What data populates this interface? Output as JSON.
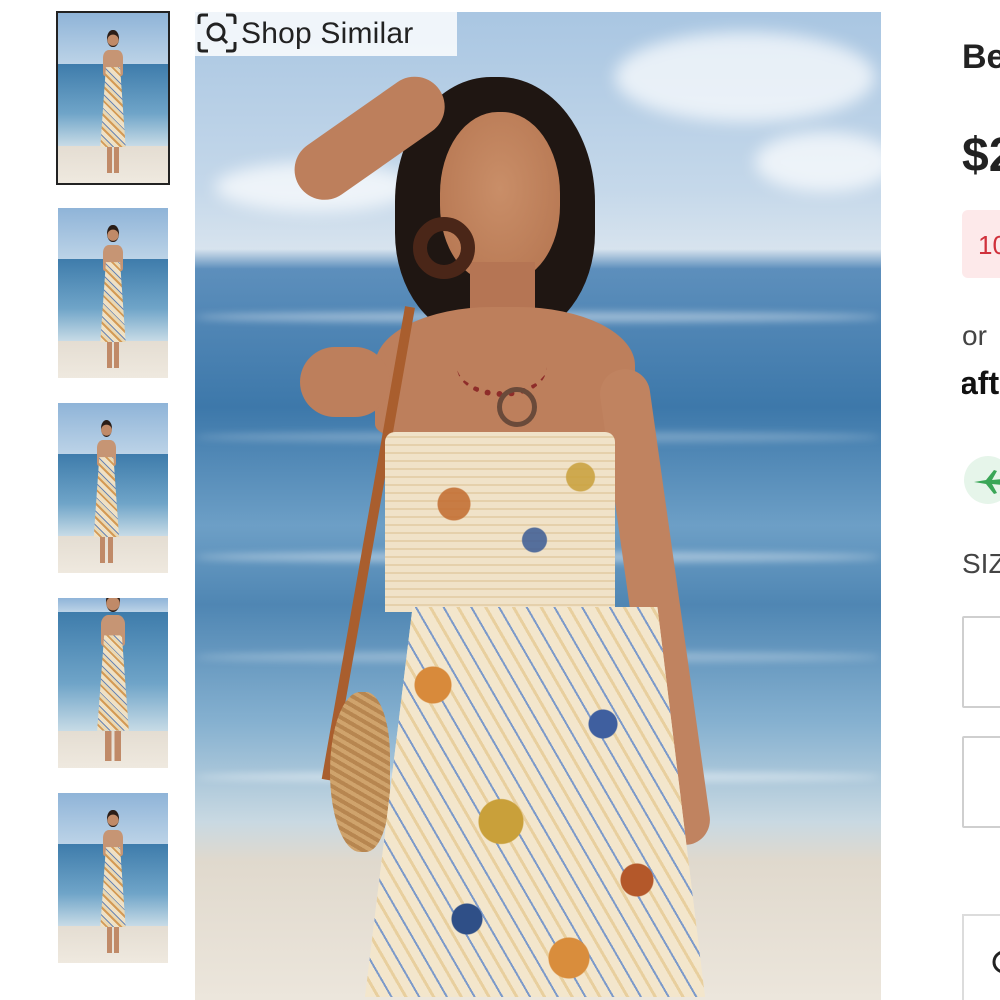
{
  "thumbnails": [
    {
      "alt": "",
      "selected": true
    },
    {
      "alt": "",
      "selected": false
    },
    {
      "alt": "",
      "selected": false
    },
    {
      "alt": "",
      "selected": false
    },
    {
      "alt": "",
      "selected": false
    }
  ],
  "shop_similar": {
    "label": "Shop Similar",
    "icon": "visual-search-icon"
  },
  "product": {
    "title_partial": "Be",
    "price_partial": "$2",
    "discount_partial": "10",
    "pay_line_partial": "or",
    "afterpay_partial": "aft",
    "size_label_partial": "SIZ"
  },
  "icons": {
    "shipping": "airplane-icon",
    "bottom_action": "search-icon"
  },
  "colors": {
    "discount_bg": "#fde9ea",
    "discount_text": "#d0313c",
    "shipping_bg": "#e6f5ea",
    "shipping_icon": "#3aa657"
  }
}
